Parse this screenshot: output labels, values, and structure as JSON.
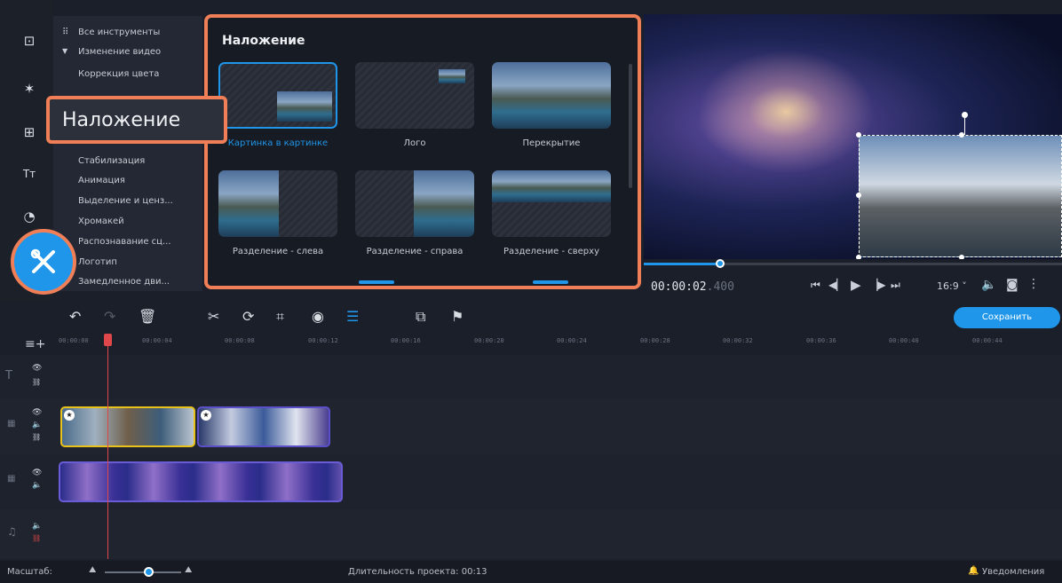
{
  "tools_list": [
    "Все инструменты",
    "Изменение видео",
    "Коррекция цвета",
    "Стабилизация",
    "Анимация",
    "Выделение и ценз...",
    "Хромакей",
    "Распознавание сц...",
    "Логотип",
    "Замедленное дви..."
  ],
  "callout_label": "Наложение",
  "overlay": {
    "title": "Наложение",
    "items": [
      "Картинка в картинке",
      "Лого",
      "Перекрытие",
      "Разделение - слева",
      "Разделение - справа",
      "Разделение - сверху"
    ]
  },
  "player": {
    "time_main": "00:00:02",
    "time_frac": ".400",
    "aspect": "16:9 ˅"
  },
  "save_label": "Сохранить",
  "ruler_ticks": [
    "00:00:00",
    "00:00:04",
    "00:00:08",
    "00:00:12",
    "00:00:16",
    "00:00:20",
    "00:00:24",
    "00:00:28",
    "00:00:32",
    "00:00:36",
    "00:00:40",
    "00:00:44"
  ],
  "status": {
    "zoom_label": "Масштаб:",
    "duration": "Длительность проекта: 00:13",
    "notifications": "Уведомления"
  },
  "colors": {
    "accent": "#1f96ea",
    "callout_border": "#f07f57",
    "playhead": "#e0474a",
    "selected_clip": "#e8c11b"
  }
}
